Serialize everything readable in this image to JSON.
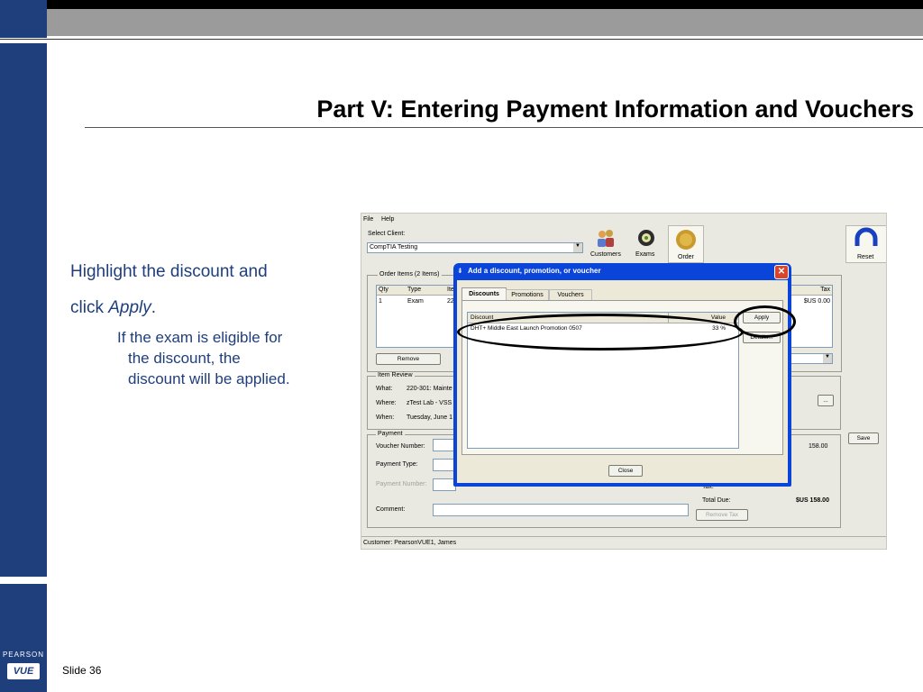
{
  "slide": {
    "title": "Part V: Entering Payment Information and Vouchers",
    "instruction_line1": "Highlight the discount and",
    "instruction_line2_prefix": "click ",
    "instruction_line2_em": "Apply",
    "instruction_line2_suffix": ".",
    "sub_line1": "If the exam is eligible for",
    "sub_line2": "the discount, the",
    "sub_line3": "discount will be applied.",
    "footer_brand": "PEARSON",
    "footer_logo": "VUE",
    "slide_number": "Slide 36"
  },
  "app": {
    "menu": {
      "file": "File",
      "help": "Help"
    },
    "select_client_label": "Select Client:",
    "client_value": "CompTIA Testing",
    "toolbar": {
      "customers": "Customers",
      "exams": "Exams",
      "order": "Order",
      "reset": "Reset"
    },
    "order_items_label": "Order Items (2 Items)",
    "order_table": {
      "headers": [
        "Qty",
        "Type",
        "Ite"
      ],
      "row": [
        "1",
        "Exam",
        "22"
      ],
      "tax_header": "Tax",
      "tax_value": "$US 0.00"
    },
    "remove_button": "Remove",
    "item_review": {
      "label": "Item Review",
      "what_label": "What:",
      "what_value": "220-301: Mainte",
      "where_label": "Where:",
      "where_value": "zTest Lab - VSS",
      "when_label": "When:",
      "when_value": "Tuesday, June 1"
    },
    "ellipsis_button": "...",
    "save_button": "Save",
    "payment": {
      "label": "Payment",
      "voucher_label": "Voucher Number:",
      "type_label": "Payment Type:",
      "number_label": "Payment Number:",
      "comment_label": "Comment:",
      "amount": "158.00",
      "tax_label": "Tax:",
      "total_label": "Total Due:",
      "total_value": "$US 158.00",
      "remove_tax_button": "Remove Tax"
    },
    "status_bar": "Customer: PearsonVUE1, James"
  },
  "dialog": {
    "title": "Add a discount, promotion, or voucher",
    "tabs": [
      "Discounts",
      "Promotions",
      "Vouchers"
    ],
    "table_headers": {
      "discount": "Discount",
      "value": "Value"
    },
    "rows": [
      {
        "name": "DHT+ Middle East Launch Promotion 0507",
        "value": "33 %"
      }
    ],
    "apply_button": "Apply",
    "details_button": "Details...",
    "close_button": "Close"
  }
}
